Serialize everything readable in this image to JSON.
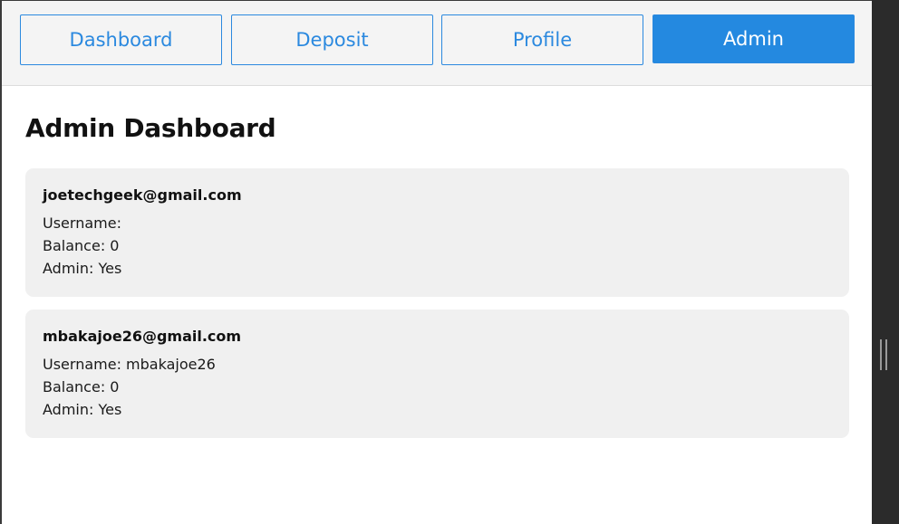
{
  "nav": {
    "items": [
      {
        "label": "Dashboard",
        "active": false
      },
      {
        "label": "Deposit",
        "active": false
      },
      {
        "label": "Profile",
        "active": false
      },
      {
        "label": "Admin",
        "active": true
      }
    ]
  },
  "page": {
    "title": "Admin Dashboard"
  },
  "users": [
    {
      "email": "joetechgeek@gmail.com",
      "username": "Username: ",
      "balance": "Balance: 0",
      "admin": "Admin: Yes"
    },
    {
      "email": "mbakajoe26@gmail.com",
      "username": "Username: mbakajoe26",
      "balance": "Balance: 0",
      "admin": "Admin: Yes"
    }
  ],
  "colors": {
    "accent": "#2489e0",
    "card_bg": "#f0f0f0",
    "nav_bg": "#f4f4f4"
  }
}
